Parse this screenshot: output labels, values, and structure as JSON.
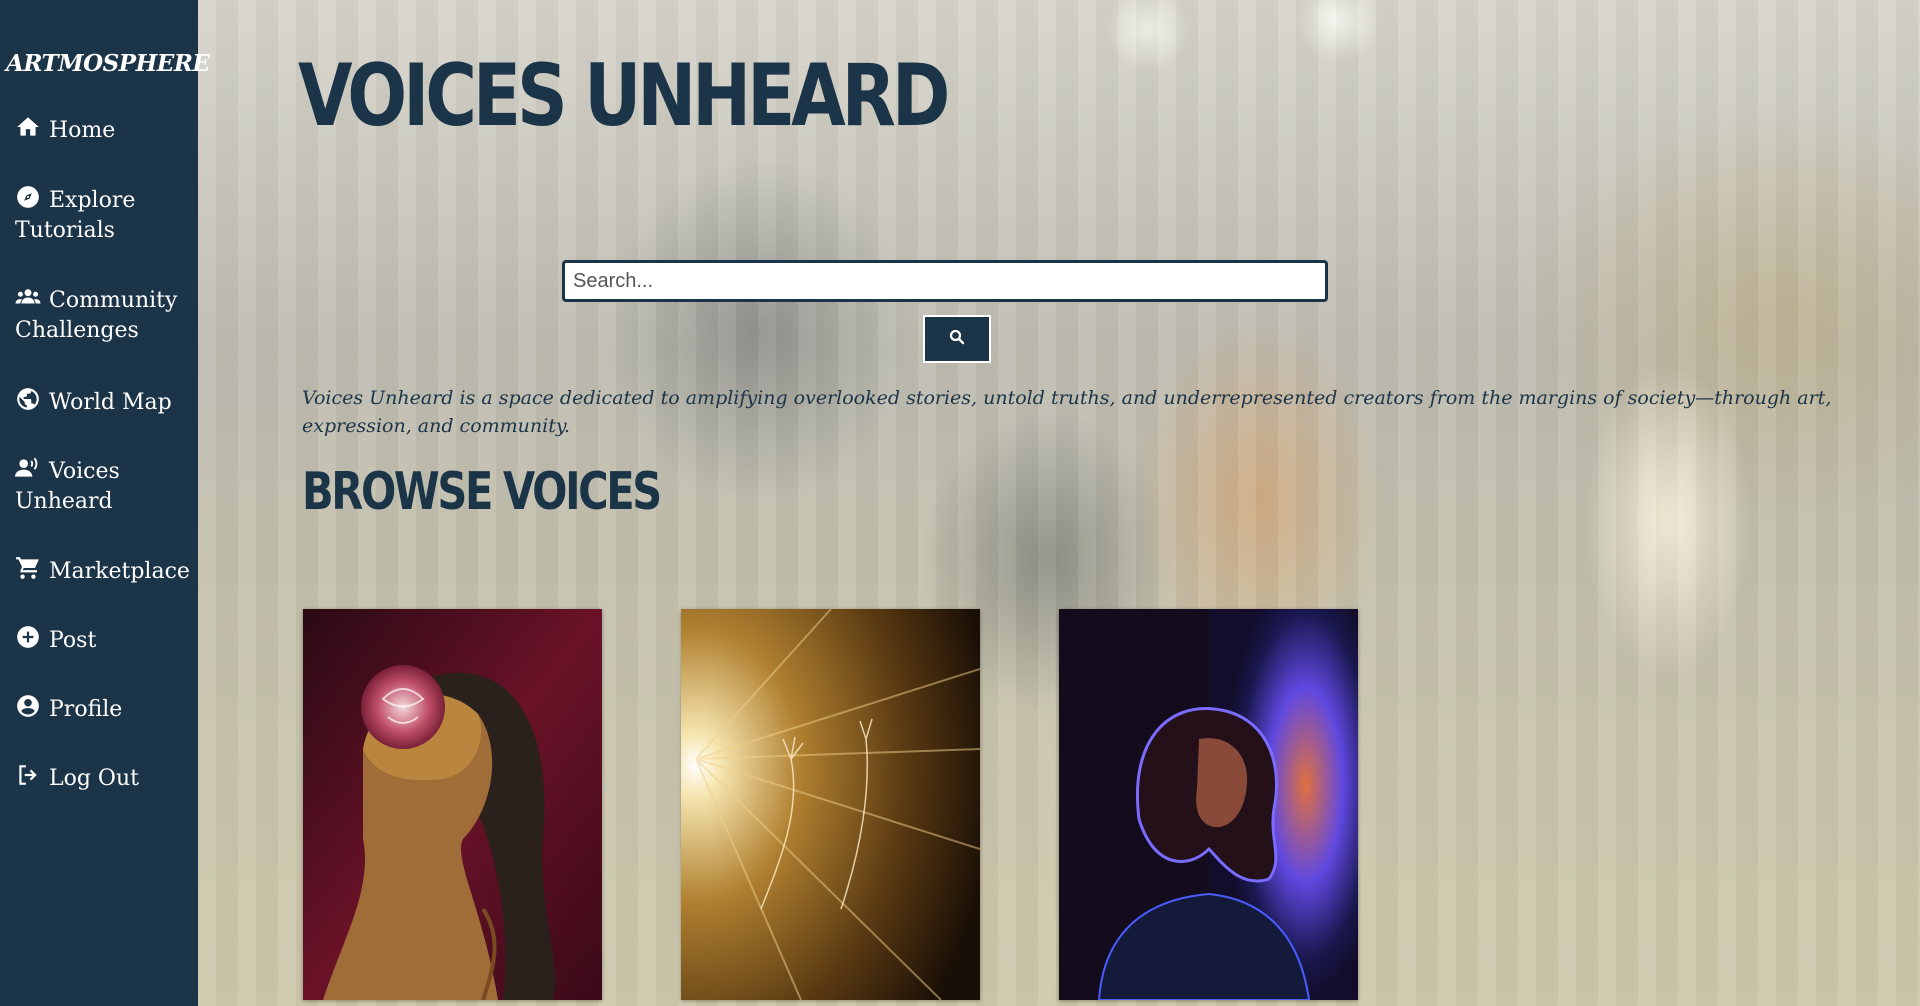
{
  "sidebar": {
    "logo": "ARTMOSPHERE",
    "items": [
      {
        "label": "Home",
        "icon": "home-icon"
      },
      {
        "label": "Explore Tutorials",
        "icon": "compass-icon"
      },
      {
        "label": "Community Challenges",
        "icon": "users-icon"
      },
      {
        "label": "World Map",
        "icon": "globe-icon"
      },
      {
        "label": "Voices Unheard",
        "icon": "speaking-user-icon"
      },
      {
        "label": "Marketplace",
        "icon": "cart-icon"
      },
      {
        "label": "Post",
        "icon": "plus-circle-icon"
      },
      {
        "label": "Profile",
        "icon": "user-circle-icon"
      },
      {
        "label": "Log Out",
        "icon": "logout-icon"
      }
    ]
  },
  "main": {
    "title": "VOICES UNHEARD",
    "search": {
      "placeholder": "Search...",
      "button_icon": "search-icon"
    },
    "description": "Voices Unheard is a space dedicated to amplifying overlooked stories, untold truths, and underrepresented creators from the margins of society—through art, expression, and community.",
    "browse_title": "BROWSE VOICES",
    "artworks": [
      {
        "subject": "woman with rose"
      },
      {
        "subject": "light burst hands"
      },
      {
        "subject": "neon portrait"
      }
    ]
  },
  "colors": {
    "primary": "#1c3448",
    "text_light": "#ffffff"
  }
}
